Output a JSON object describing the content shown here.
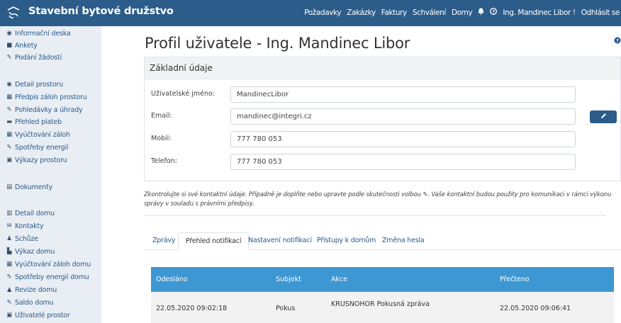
{
  "header": {
    "brand": "Stavební bytové družstvo",
    "nav": [
      "Požadavky",
      "Zakázky",
      "Faktury",
      "Schválení",
      "Domy"
    ],
    "user": "Ing. Mandinec Libor !",
    "logout": "Odhlásit se",
    "bell_icon": "bell-icon",
    "help_icon": "question-circle-icon"
  },
  "sidebar": {
    "group1": [
      {
        "label": "Informační deska",
        "icon": "rss-icon"
      },
      {
        "label": "Ankety",
        "icon": "poll-icon"
      },
      {
        "label": "Podání žádostí",
        "icon": "wrench-icon"
      }
    ],
    "group2": [
      {
        "label": "Detail prostoru",
        "icon": "eye-icon"
      },
      {
        "label": "Předpis záloh prostoru",
        "icon": "calculator-icon"
      },
      {
        "label": "Pohledávky a úhrady",
        "icon": "edit-icon"
      },
      {
        "label": "Přehled plateb",
        "icon": "card-icon"
      },
      {
        "label": "Vyúčtování záloh",
        "icon": "calculator-icon"
      },
      {
        "label": "Spotřeby energií",
        "icon": "wrench-icon"
      },
      {
        "label": "Výkazy prostoru",
        "icon": "video-icon"
      }
    ],
    "group3": [
      {
        "label": "Dokumenty",
        "icon": "file-icon"
      }
    ],
    "group4": [
      {
        "label": "Detail domu",
        "icon": "building-icon"
      },
      {
        "label": "Kontakty",
        "icon": "envelope-icon"
      },
      {
        "label": "Schůze",
        "icon": "person-icon"
      },
      {
        "label": "Výkaz domu",
        "icon": "chart-icon"
      },
      {
        "label": "Vyúčtování záloh domu",
        "icon": "calculator-icon"
      },
      {
        "label": "Spotřeby energií domu",
        "icon": "wrench-icon"
      },
      {
        "label": "Revize domu",
        "icon": "bell-icon"
      },
      {
        "label": "Saldo domu",
        "icon": "edit-icon"
      },
      {
        "label": "Uživatelé prostor",
        "icon": "id-card-icon"
      }
    ]
  },
  "main": {
    "title": "Profil uživatele - Ing. Mandinec Libor",
    "card_title": "Základní údaje",
    "fields": [
      {
        "label": "Uživatelské jméno:",
        "value": "MandinecLibor"
      },
      {
        "label": "Email:",
        "value": "mandinec@integri.cz"
      },
      {
        "label": "Mobil:",
        "value": "777 780 053"
      },
      {
        "label": "Telefon:",
        "value": "777 780 053"
      }
    ],
    "edit_icon": "pencil-icon",
    "note": "Zkontrolujte si své kontaktní údaje. Případně je doplňte nebo upravte podle skutečnosti volbou ✎. Vaše kontaktní budou použity pro komunikaci v rámci výkonu správy v souladu s právními předpisy.",
    "tabs": [
      "Zprávy",
      "Přehled notifikací",
      "Nastavení notifikací",
      "Přístupy k domům",
      "Změna hesla"
    ],
    "active_tab": "Přehled notifikací"
  },
  "table": {
    "columns": [
      "Odesláno",
      "Subjekt",
      "Akce",
      "Přečteno"
    ],
    "rows": [
      [
        "22.05.2020 09:02:18",
        "Pokus",
        "KRUSNOHOR Pokusná zpráva",
        "22.05.2020 09:06:41"
      ]
    ]
  },
  "colors": {
    "header_bg": "#2c5c89",
    "sidebar_bg": "#e9eef4",
    "table_head_bg": "#3d97d3",
    "link": "#2a5a8a"
  }
}
